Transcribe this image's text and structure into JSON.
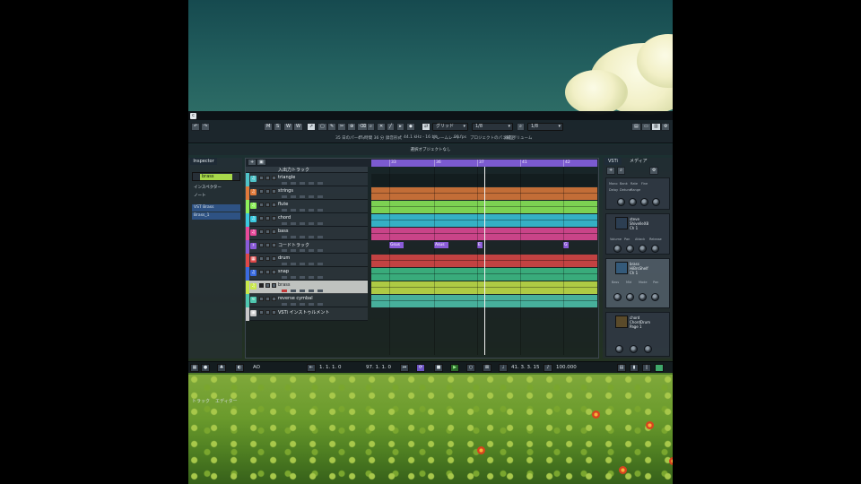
{
  "colors": {
    "accent_purple": "#7b5ad0",
    "selected_track_green": "#a8d84b",
    "selection_blue": "#2f5f9c"
  },
  "toolbar": {
    "mode_buttons": [
      "M",
      "S",
      "W",
      "W"
    ],
    "grid_label": "グリッド",
    "quantize_label": "1/8",
    "bar_label": "1/8",
    "info": [
      "35 日のパーティ",
      "47 時間 36 分",
      "録音形式",
      "44.1 kHz - 16 bit",
      "フレームレート",
      "90 fps",
      "プロジェクトのパン補正",
      "録音ボリューム"
    ]
  },
  "message": "選択オブジェクトなし",
  "inspector": {
    "tab": "Inspector",
    "selected_track": "brass",
    "rows": [
      "インスペクター",
      "ノート",
      "VST Brass",
      "Brass_1"
    ],
    "bottom_tabs": [
      "トラック",
      "エディター"
    ]
  },
  "ruler": {
    "marks": [
      "33",
      "36",
      "37",
      "39",
      "41",
      "42"
    ]
  },
  "folder_label": "入出力トラック",
  "tracks": [
    {
      "name": "triangle",
      "icon": "piano-roll-icon",
      "color": "#4fc3c8",
      "lane": "#000000",
      "selected": false
    },
    {
      "name": "strings",
      "icon": "piano-roll-icon",
      "color": "#e07a3a",
      "lane": "#e07a3a",
      "selected": false
    },
    {
      "name": "flute",
      "icon": "piano-roll-icon",
      "color": "#8ef05a",
      "lane": "#8ef05a",
      "selected": false
    },
    {
      "name": "chord",
      "icon": "piano-roll-icon",
      "color": "#3ac9e0",
      "lane": "#3ac9e0",
      "selected": false
    },
    {
      "name": "bass",
      "icon": "piano-roll-icon",
      "color": "#e84a9a",
      "lane": "#e84a9a",
      "selected": false
    },
    {
      "name": "コードトラック",
      "icon": "chord-track-icon",
      "color": "#8a5bd8",
      "lane": "chord",
      "selected": false
    },
    {
      "name": "drum",
      "icon": "drum-icon",
      "color": "#e04848",
      "lane": "#e04848",
      "selected": false
    },
    {
      "name": "snap",
      "icon": "piano-roll-icon",
      "color": "#3a6be0",
      "lane": "#3fc38a",
      "selected": false
    },
    {
      "name": "brass",
      "icon": "piano-roll-icon",
      "color": "#c8e84a",
      "lane": "#c8e84a",
      "selected": true
    },
    {
      "name": "reverse cymbal",
      "icon": "audio-icon",
      "color": "#4fc8b0",
      "lane": "#4fc8b0",
      "selected": false
    },
    {
      "name": "VSTi インストゥルメント",
      "icon": "folder-icon",
      "color": "#c8c8c8",
      "lane": "none",
      "selected": false
    }
  ],
  "chords": [
    "Gsus",
    "Asus",
    "E",
    "G"
  ],
  "rack": {
    "tabs": [
      "VSTi",
      "メディア"
    ],
    "channel_labels": [
      "Mono",
      "Bank",
      "Rate",
      "Fine",
      "Delay",
      "Detune",
      "Range"
    ],
    "instruments": [
      {
        "name": "steve\nShivelleX8\nCh 1",
        "knob_labels": [
          "Volume",
          "Pan",
          "Attack",
          "Release"
        ]
      },
      {
        "name": "brass\nHiBrsShelf\nCh 1",
        "knob_labels": [
          "Bass",
          "Mid",
          "Mode",
          "Pan"
        ]
      },
      {
        "name": "chord\nChordDrum\nPage 1",
        "knob_labels": [
          "",
          "",
          ""
        ]
      }
    ]
  },
  "transport": {
    "left_locator": "1. 1. 1. 0",
    "right_locator": "97. 1. 1. 0",
    "position": "41. 3. 3. 15",
    "tempo": "100.000",
    "left_mode": "AO"
  }
}
